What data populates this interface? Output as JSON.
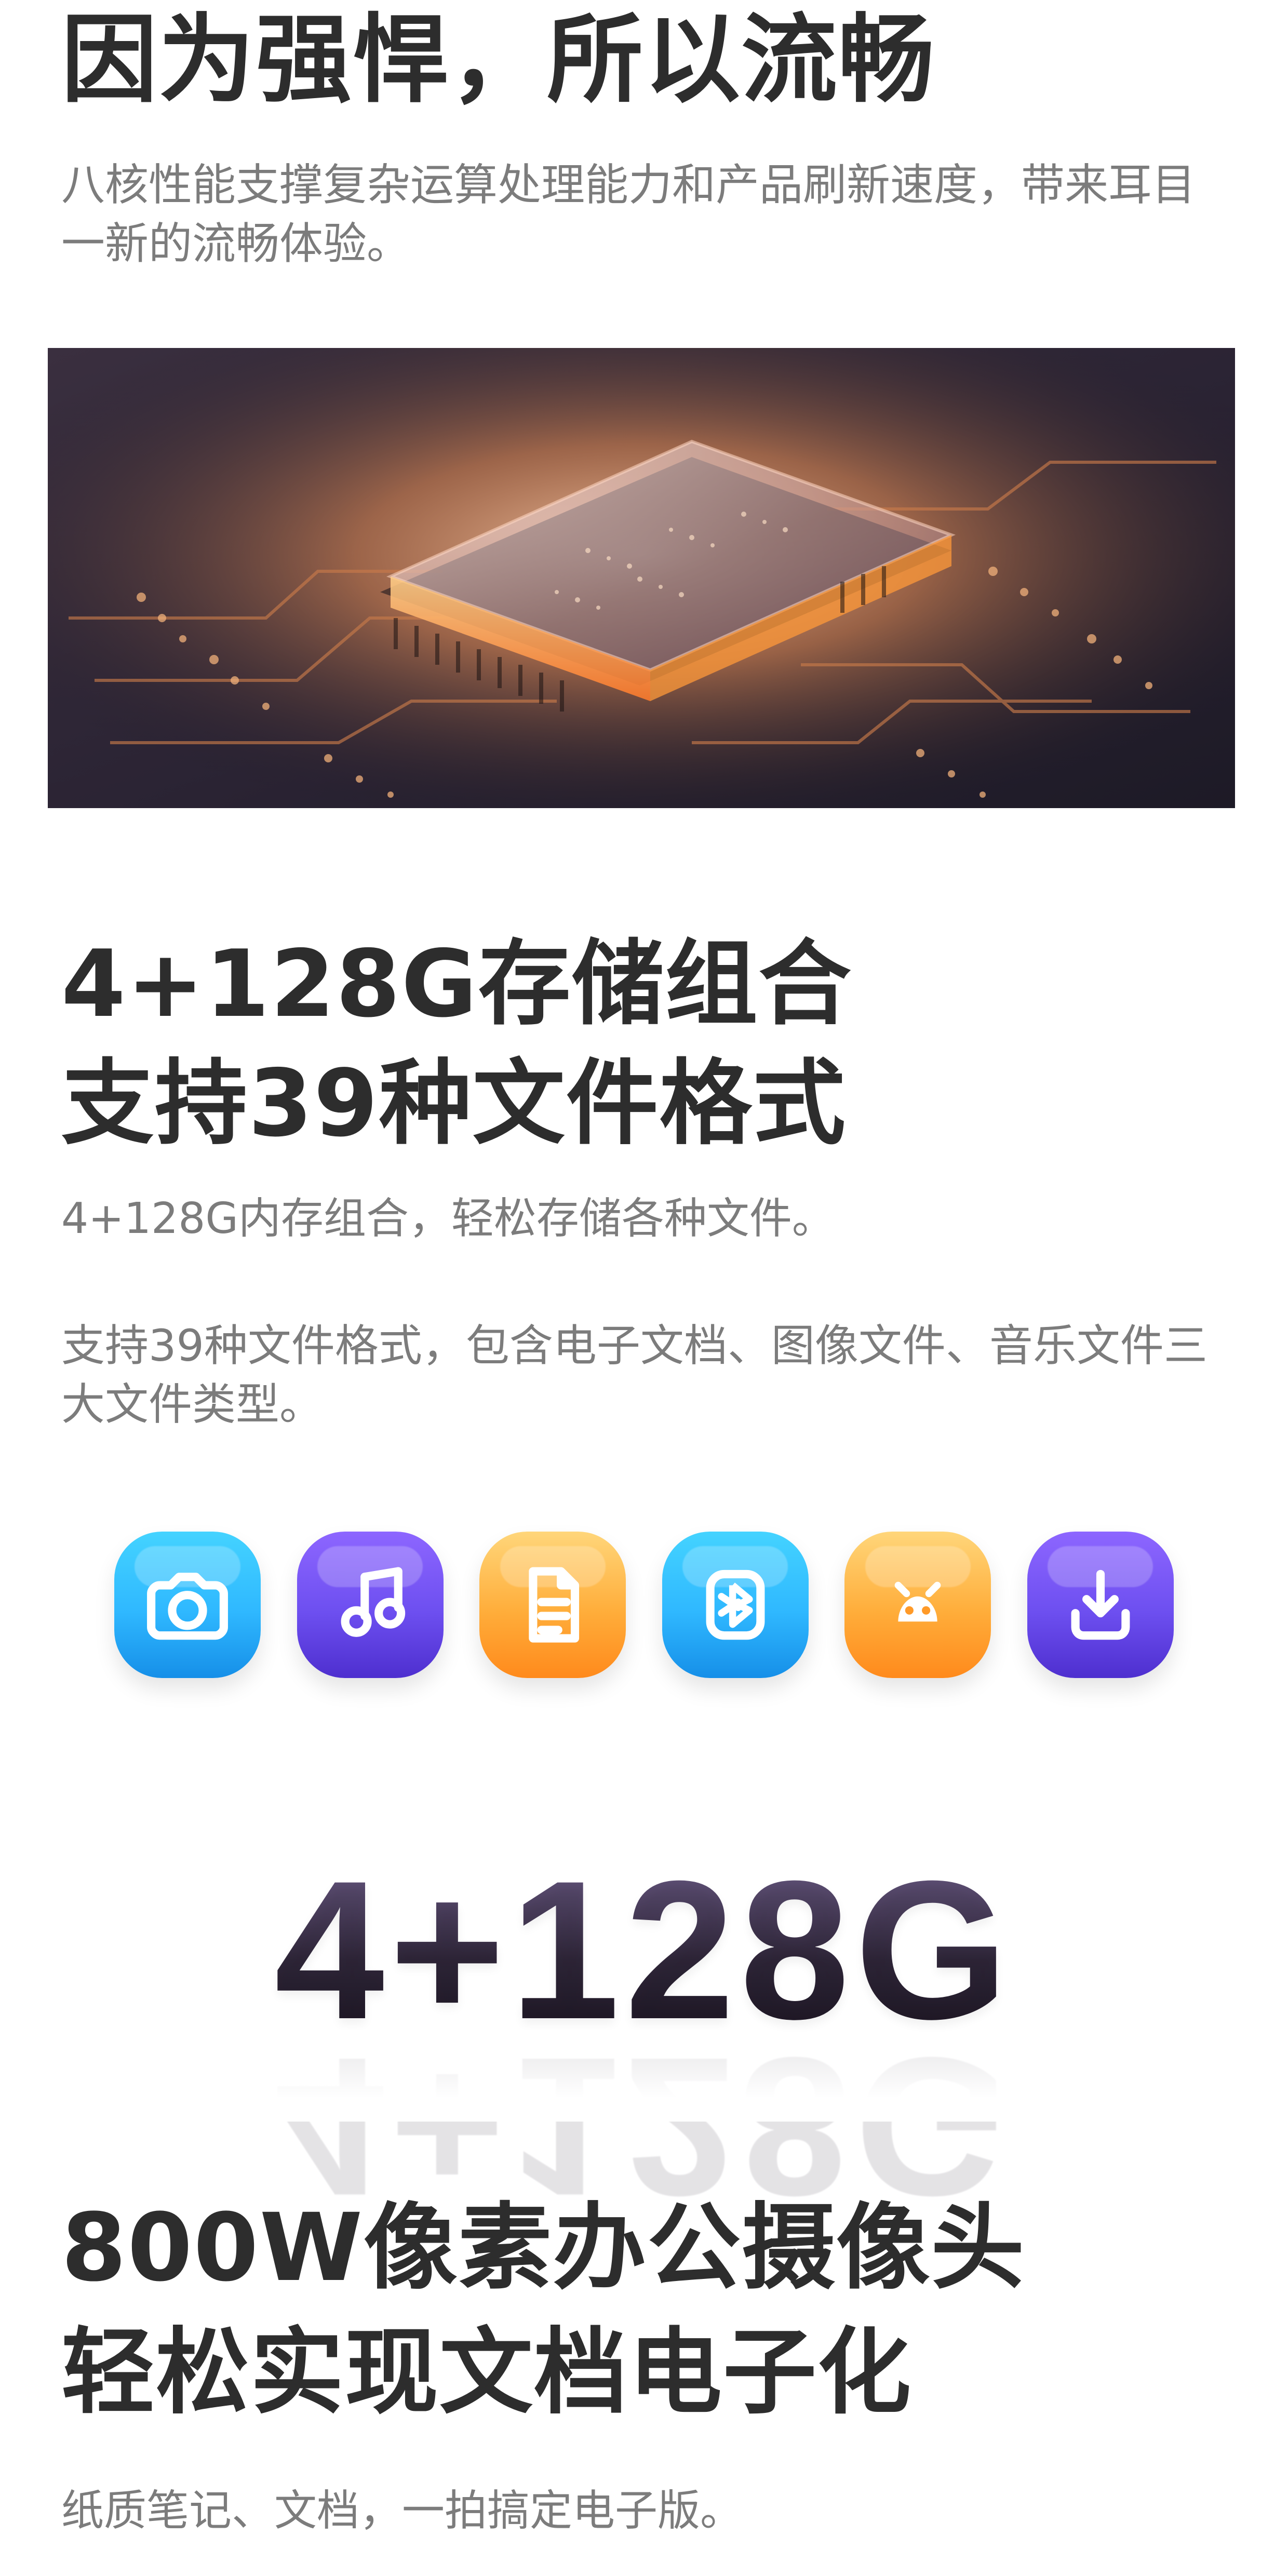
{
  "section_performance": {
    "title": "因为强悍，所以流畅",
    "description": "八核性能支撑复杂运算处理能力和产品刷新速度，带来耳目一新的流畅体验。"
  },
  "section_storage": {
    "title_line1": "4+128G存储组合",
    "title_line2": "支持39种文件格式",
    "description_line1": "4+128G内存组合，轻松存储各种文件。",
    "description_line2": "支持39种文件格式，包含电子文档、图像文件、音乐文件三大文件类型。",
    "icons": [
      {
        "name": "camera-icon"
      },
      {
        "name": "music-icon"
      },
      {
        "name": "document-icon"
      },
      {
        "name": "bluetooth-icon"
      },
      {
        "name": "android-icon"
      },
      {
        "name": "download-icon"
      }
    ]
  },
  "capacity_badge": {
    "text": "4+128G"
  },
  "section_camera": {
    "title_line1": "800W像素办公摄像头",
    "title_line2": "轻松实现文档电子化",
    "description": "纸质笔记、文档，一拍搞定电子版。"
  }
}
